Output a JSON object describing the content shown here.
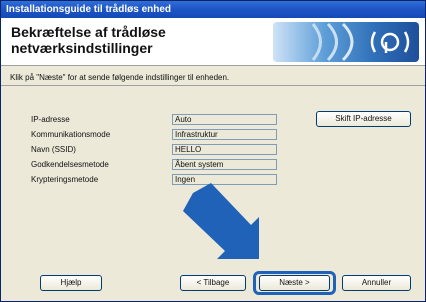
{
  "window": {
    "title": "Installationsguide til trådløs enhed"
  },
  "header": {
    "title": "Bekræftelse af trådløse netværksindstillinger"
  },
  "instruction": "Klik på \"Næste\" for at sende følgende indstillinger til enheden.",
  "settings": [
    {
      "label": "IP-adresse",
      "value": "Auto"
    },
    {
      "label": "Kommunikationsmode",
      "value": "Infrastruktur"
    },
    {
      "label": "Navn (SSID)",
      "value": "HELLO"
    },
    {
      "label": "Godkendelsesmetode",
      "value": "Åbent system"
    },
    {
      "label": "Krypteringsmetode",
      "value": "Ingen"
    }
  ],
  "buttons": {
    "change_ip": "Skift IP-adresse",
    "help": "Hjælp",
    "back": "< Tilbage",
    "next": "Næste >",
    "cancel": "Annuller"
  },
  "icons": {
    "banner": "wireless-signal-icon",
    "pointer": "arrow-pointer-icon"
  },
  "colors": {
    "titlebar": "#1f56c6",
    "highlight": "#1f62b8",
    "arrow": "#1f62b8"
  }
}
